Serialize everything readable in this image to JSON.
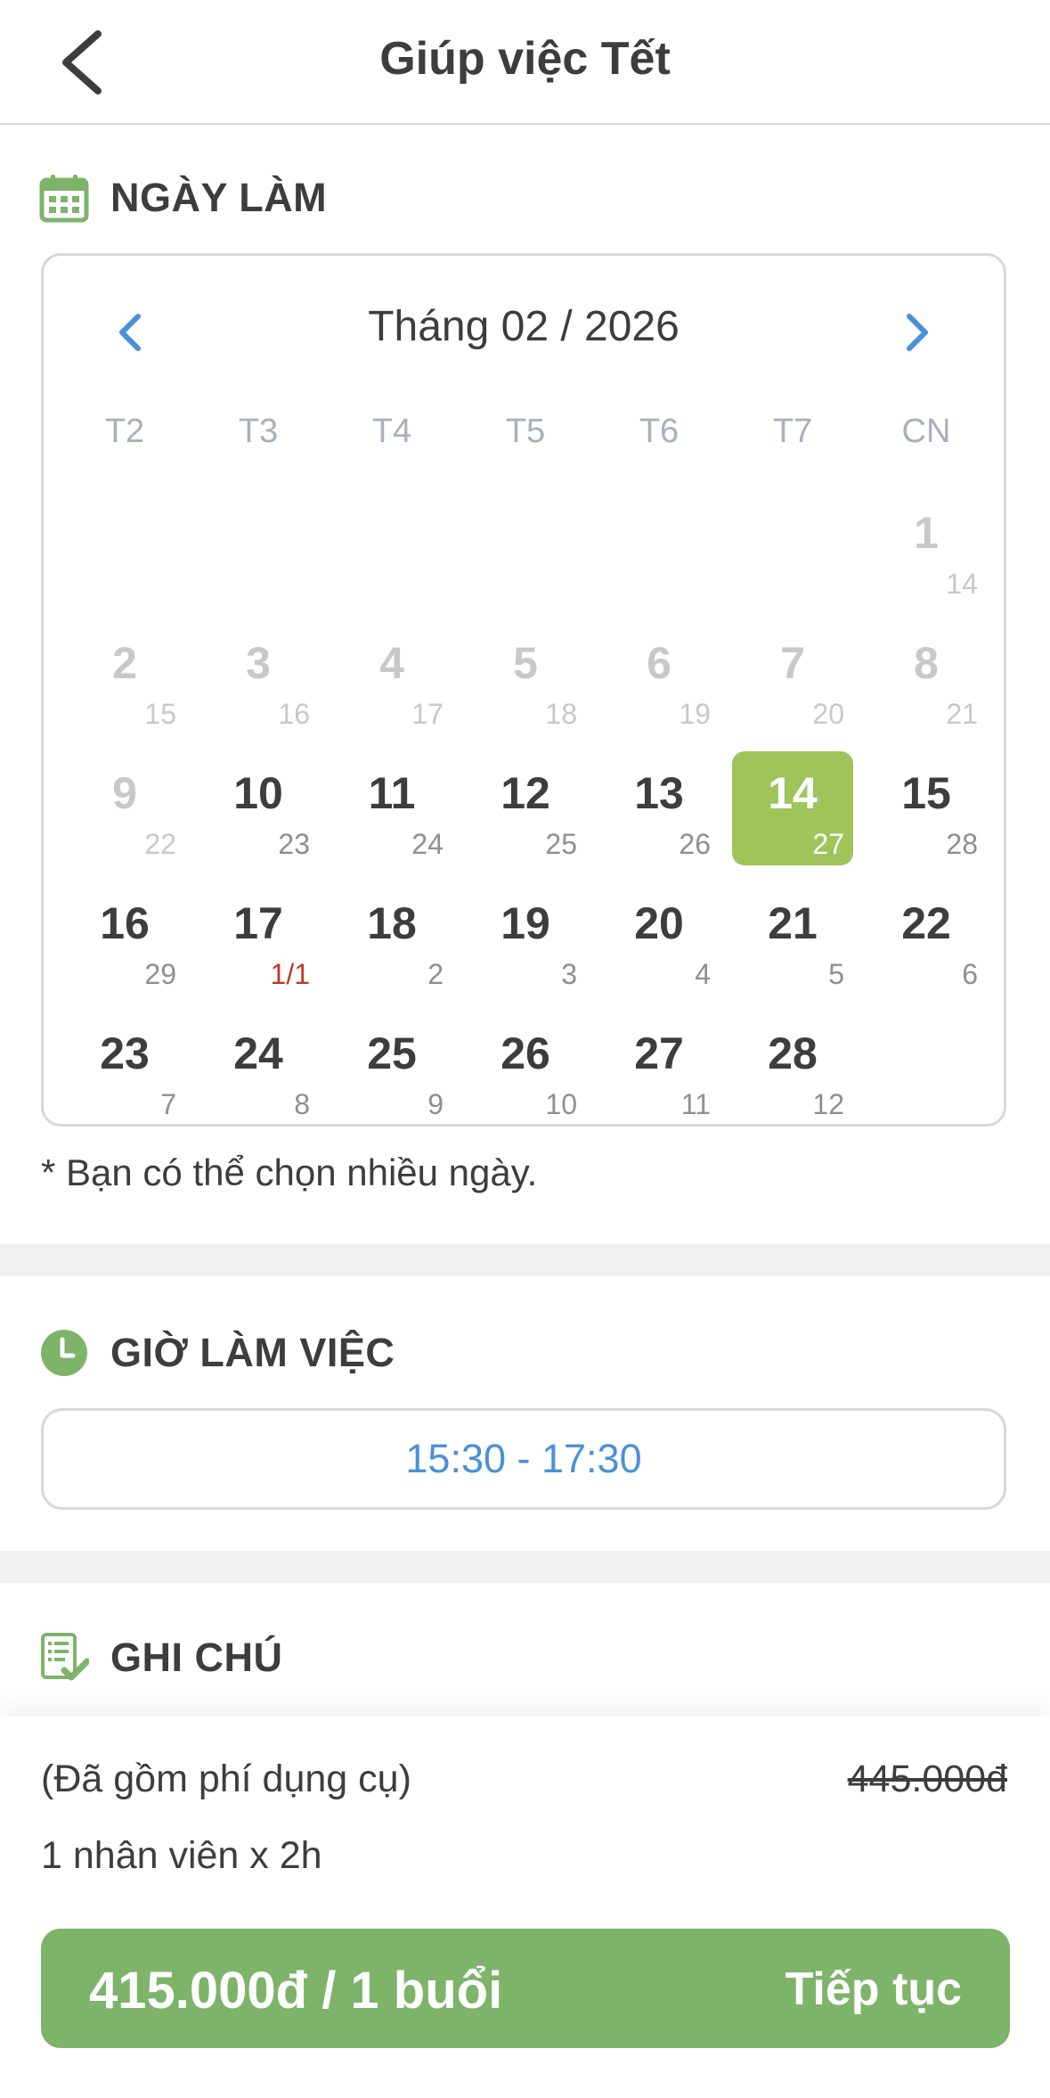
{
  "header": {
    "title": "Giúp việc Tết"
  },
  "work_date": {
    "section_label": "NGÀY LÀM",
    "month_title": "Tháng 02 / 2026",
    "weekdays": [
      "T2",
      "T3",
      "T4",
      "T5",
      "T6",
      "T7",
      "CN"
    ],
    "days": [
      {
        "day": "1",
        "lunar": "14",
        "status": "past"
      },
      {
        "day": "2",
        "lunar": "15",
        "status": "past"
      },
      {
        "day": "3",
        "lunar": "16",
        "status": "past"
      },
      {
        "day": "4",
        "lunar": "17",
        "status": "past"
      },
      {
        "day": "5",
        "lunar": "18",
        "status": "past"
      },
      {
        "day": "6",
        "lunar": "19",
        "status": "past"
      },
      {
        "day": "7",
        "lunar": "20",
        "status": "past"
      },
      {
        "day": "8",
        "lunar": "21",
        "status": "past"
      },
      {
        "day": "9",
        "lunar": "22",
        "status": "past"
      },
      {
        "day": "10",
        "lunar": "23",
        "status": "available"
      },
      {
        "day": "11",
        "lunar": "24",
        "status": "available"
      },
      {
        "day": "12",
        "lunar": "25",
        "status": "available"
      },
      {
        "day": "13",
        "lunar": "26",
        "status": "available"
      },
      {
        "day": "14",
        "lunar": "27",
        "status": "selected"
      },
      {
        "day": "15",
        "lunar": "28",
        "status": "available"
      },
      {
        "day": "16",
        "lunar": "29",
        "status": "available"
      },
      {
        "day": "17",
        "lunar": "1/1",
        "status": "available",
        "lunar_highlight": true
      },
      {
        "day": "18",
        "lunar": "2",
        "status": "available"
      },
      {
        "day": "19",
        "lunar": "3",
        "status": "available"
      },
      {
        "day": "20",
        "lunar": "4",
        "status": "available"
      },
      {
        "day": "21",
        "lunar": "5",
        "status": "available"
      },
      {
        "day": "22",
        "lunar": "6",
        "status": "available"
      },
      {
        "day": "23",
        "lunar": "7",
        "status": "available"
      },
      {
        "day": "24",
        "lunar": "8",
        "status": "available"
      },
      {
        "day": "25",
        "lunar": "9",
        "status": "available"
      },
      {
        "day": "26",
        "lunar": "10",
        "status": "available"
      },
      {
        "day": "27",
        "lunar": "11",
        "status": "available"
      },
      {
        "day": "28",
        "lunar": "12",
        "status": "available"
      }
    ],
    "note": "* Bạn có thể chọn nhiều ngày."
  },
  "work_time": {
    "section_label": "GIỜ LÀM VIỆC",
    "value": "15:30 - 17:30"
  },
  "notes": {
    "section_label": "GHI CHÚ"
  },
  "summary": {
    "tools_included": "(Đã gồm phí dụng cụ)",
    "original_price": "445.000đ",
    "staff": "1 nhân viên x 2h",
    "price_per_session": "415.000đ / 1 buổi",
    "continue_label": "Tiếp tục"
  },
  "colors": {
    "accent_green": "#7eb36a",
    "selected_day": "#9ec45a",
    "link_blue": "#4a90d9",
    "tet_red": "#c0392b"
  }
}
